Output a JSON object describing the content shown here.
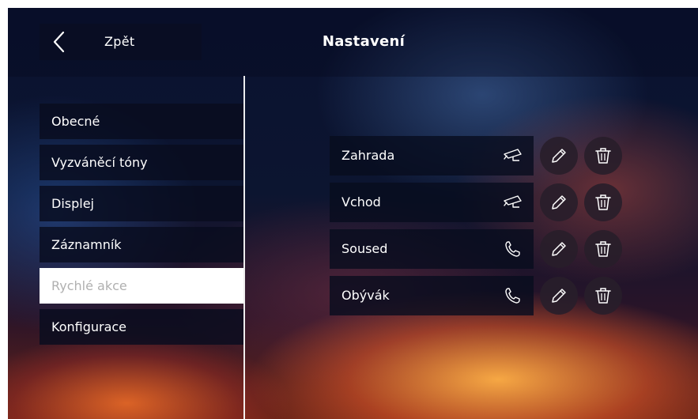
{
  "header": {
    "back_label": "Zpět",
    "title": "Nastavení"
  },
  "menu": {
    "items": [
      {
        "label": "Obecné",
        "active": false
      },
      {
        "label": "Vyzváněcí tóny",
        "active": false
      },
      {
        "label": "Displej",
        "active": false
      },
      {
        "label": "Záznamník",
        "active": false
      },
      {
        "label": "Rychlé akce",
        "active": true
      },
      {
        "label": "Konfigurace",
        "active": false
      }
    ]
  },
  "quick_actions": [
    {
      "label": "Zahrada",
      "type_icon": "camera-icon"
    },
    {
      "label": "Vchod",
      "type_icon": "camera-icon"
    },
    {
      "label": "Soused",
      "type_icon": "phone-icon"
    },
    {
      "label": "Obývák",
      "type_icon": "phone-icon"
    }
  ],
  "icons": {
    "back": "chevron-left-icon",
    "edit": "pencil-icon",
    "delete": "trash-icon"
  },
  "colors": {
    "active_menu_bg": "#ffffff",
    "active_menu_text": "#b0b0b0",
    "text": "#ffffff"
  }
}
